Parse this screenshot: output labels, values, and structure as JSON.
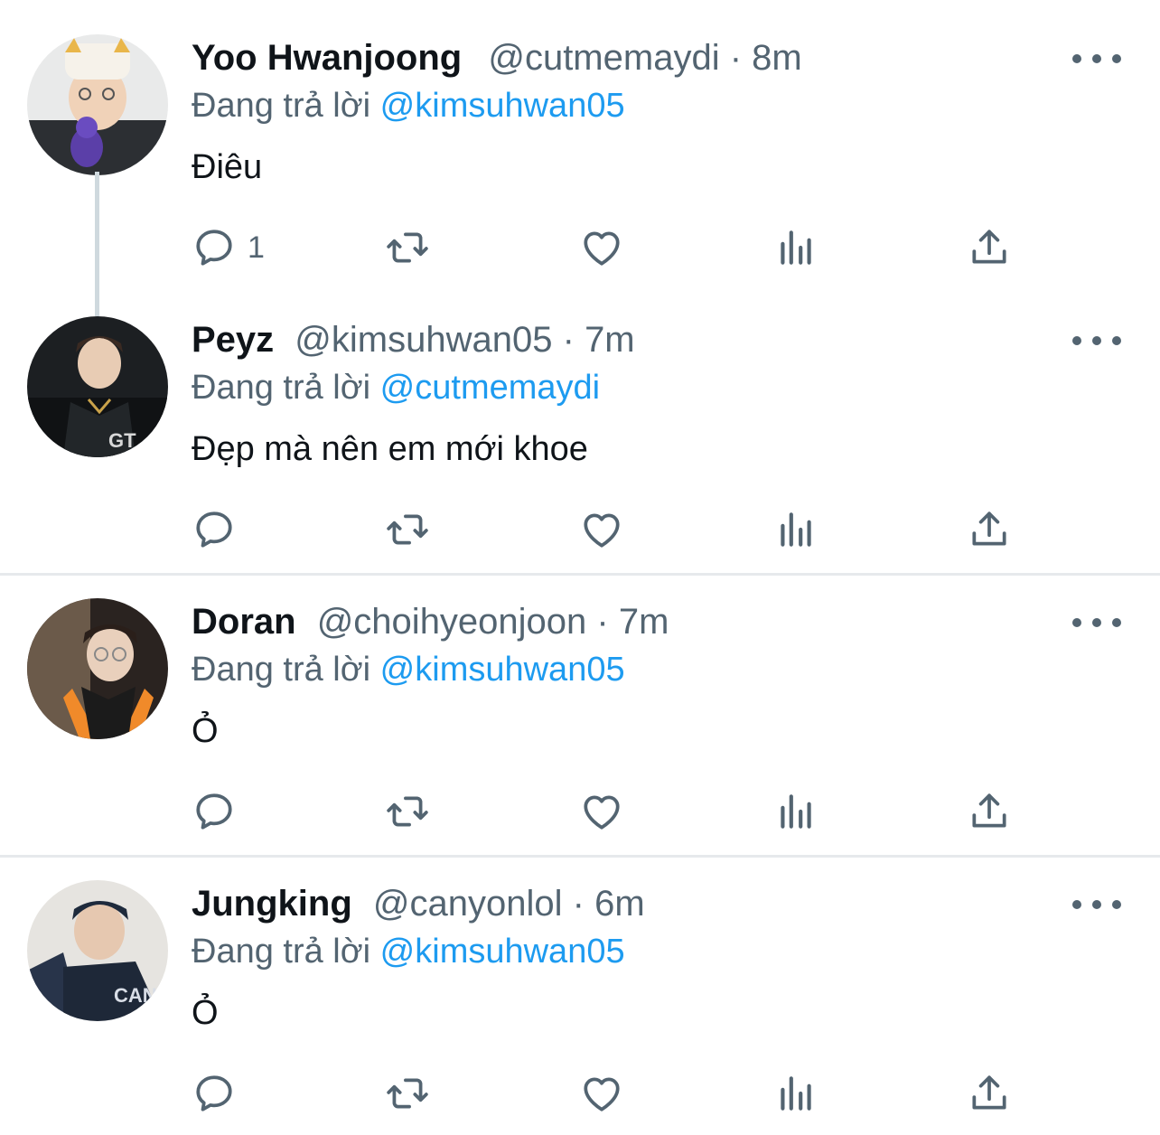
{
  "colors": {
    "accent": "#1d9bf0",
    "secondary_text": "#536471",
    "primary_text": "#0f1419",
    "divider": "#e6e9ec",
    "thread_line": "#cfd9de"
  },
  "tweets": [
    {
      "name": "Yoo Hwanjoong",
      "handle": "@cutmemaydi",
      "separator": "·",
      "time": "8m",
      "replying_prefix": "Đang trả lời",
      "replying_to": "@kimsuhwan05",
      "text": "Điêu",
      "reply_count": "1",
      "avatar_icon": "avatar-photo"
    },
    {
      "name": "Peyz",
      "handle": "@kimsuhwan05",
      "separator": "·",
      "time": "7m",
      "replying_prefix": "Đang trả lời",
      "replying_to": "@cutmemaydi",
      "text": "Đẹp mà nên em mới khoe",
      "reply_count": "",
      "avatar_icon": "avatar-photo"
    },
    {
      "name": "Doran",
      "handle": "@choihyeonjoon",
      "separator": "·",
      "time": "7m",
      "replying_prefix": "Đang trả lời",
      "replying_to": "@kimsuhwan05",
      "text": "Ỏ",
      "reply_count": "",
      "avatar_icon": "avatar-photo"
    },
    {
      "name": "Jungking",
      "handle": "@canyonlol",
      "separator": "·",
      "time": "6m",
      "replying_prefix": "Đang trả lời",
      "replying_to": "@kimsuhwan05",
      "text": "Ỏ",
      "reply_count": "",
      "avatar_icon": "avatar-photo"
    }
  ],
  "action_icons": [
    "reply-icon",
    "retweet-icon",
    "like-icon",
    "views-icon",
    "share-icon"
  ]
}
